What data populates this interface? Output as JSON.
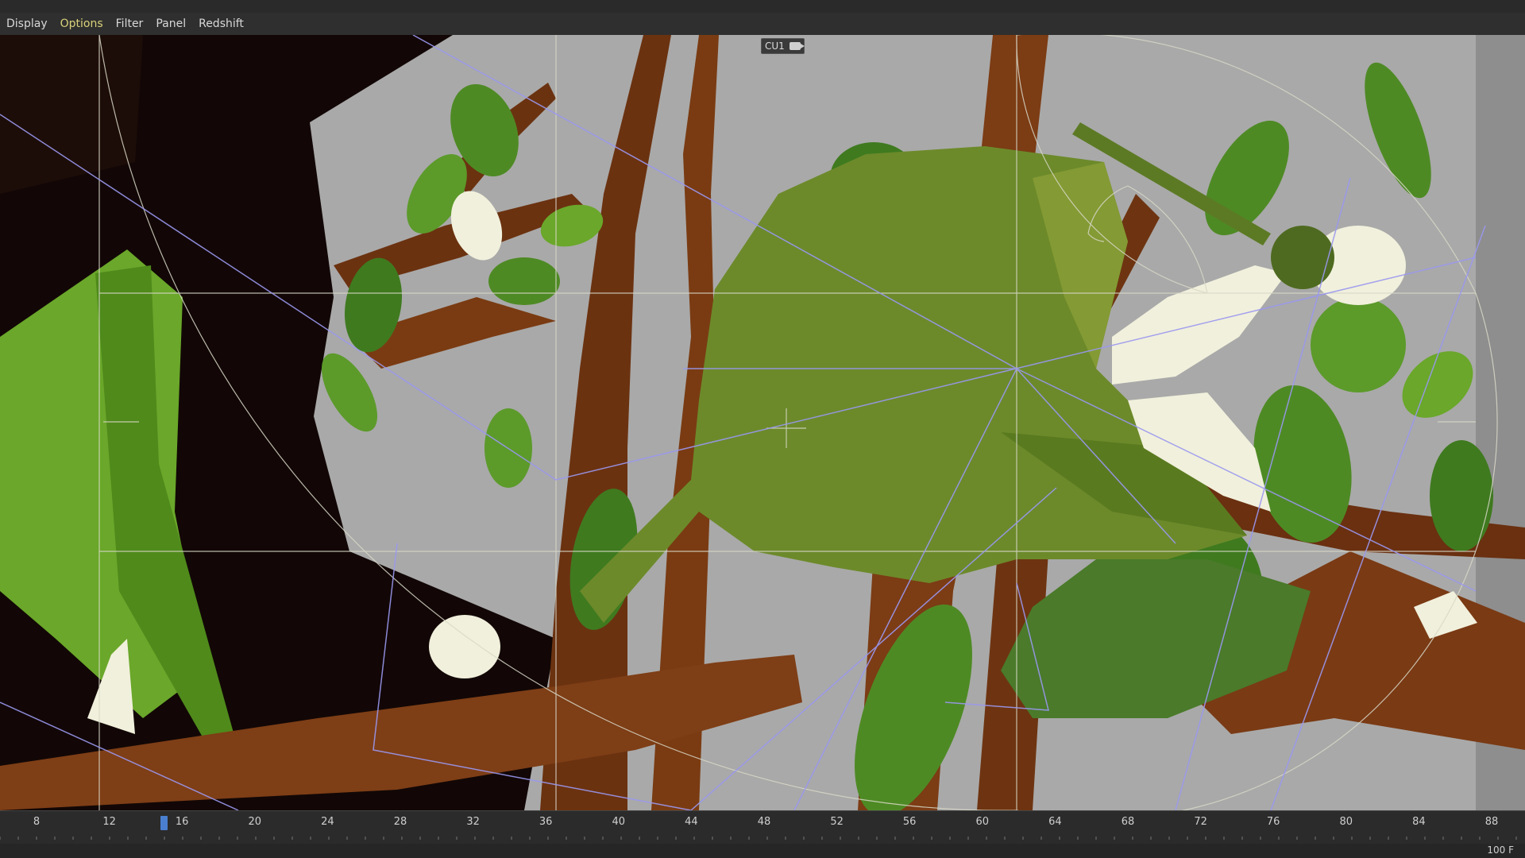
{
  "menu": [
    "Display",
    "Options",
    "Filter",
    "Panel",
    "Redshift"
  ],
  "menu_active": "Options",
  "viewport": {
    "camera_label": "CU1"
  },
  "timeline": {
    "ticks": [
      "8",
      "12",
      "16",
      "20",
      "24",
      "28",
      "32",
      "36",
      "40",
      "44",
      "48",
      "52",
      "56",
      "60",
      "64",
      "68",
      "72",
      "76",
      "80",
      "84",
      "88"
    ],
    "current_frame_marker": "15"
  },
  "status": {
    "end_frame": "100 F"
  },
  "colors": {
    "leaf": "#5a8a22",
    "branch": "#7a3b12",
    "background": "#a8a8a8",
    "flower": "#f1f0dc",
    "guide": "#9a98f0"
  }
}
